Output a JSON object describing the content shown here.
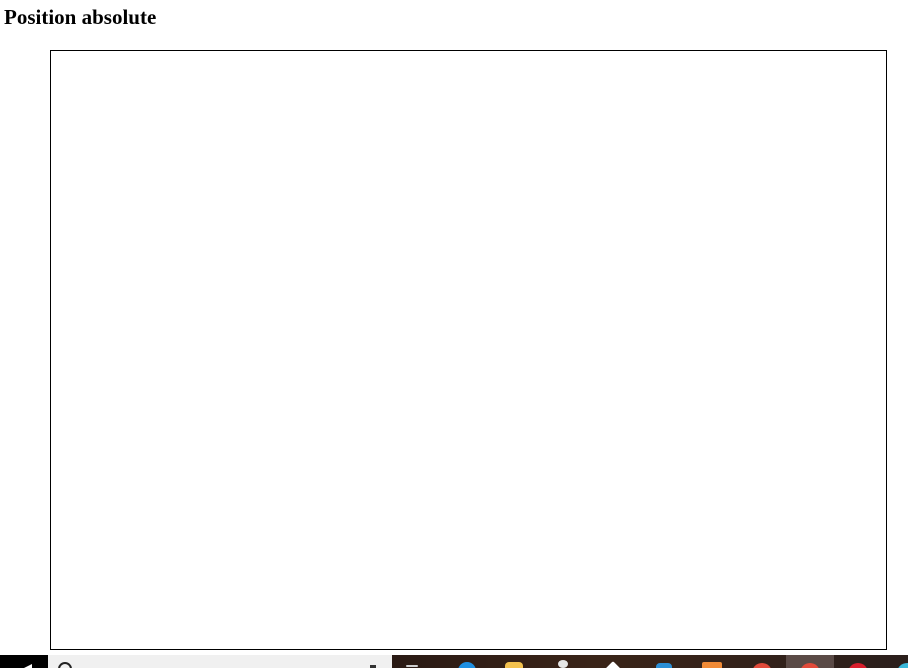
{
  "page": {
    "heading": "Position absolute"
  },
  "taskbar": {
    "icons": [
      {
        "name": "task-view-icon",
        "color": "#cfcfcf"
      },
      {
        "name": "edge-icon",
        "color": "#1e8fe1"
      },
      {
        "name": "file-explorer-icon",
        "color": "#f2c14e"
      },
      {
        "name": "pin-icon",
        "color": "#e6e6e6"
      },
      {
        "name": "store-icon",
        "color": "#ffffff"
      },
      {
        "name": "vscode-icon",
        "color": "#2b8fd6"
      },
      {
        "name": "sublime-icon",
        "color": "#f08a36"
      },
      {
        "name": "chrome-icon",
        "color": "#e04a3a"
      },
      {
        "name": "chrome-active-icon",
        "color": "#e04a3a"
      },
      {
        "name": "opera-icon",
        "color": "#d81e2c"
      },
      {
        "name": "app-icon",
        "color": "#38b6d8"
      }
    ]
  }
}
